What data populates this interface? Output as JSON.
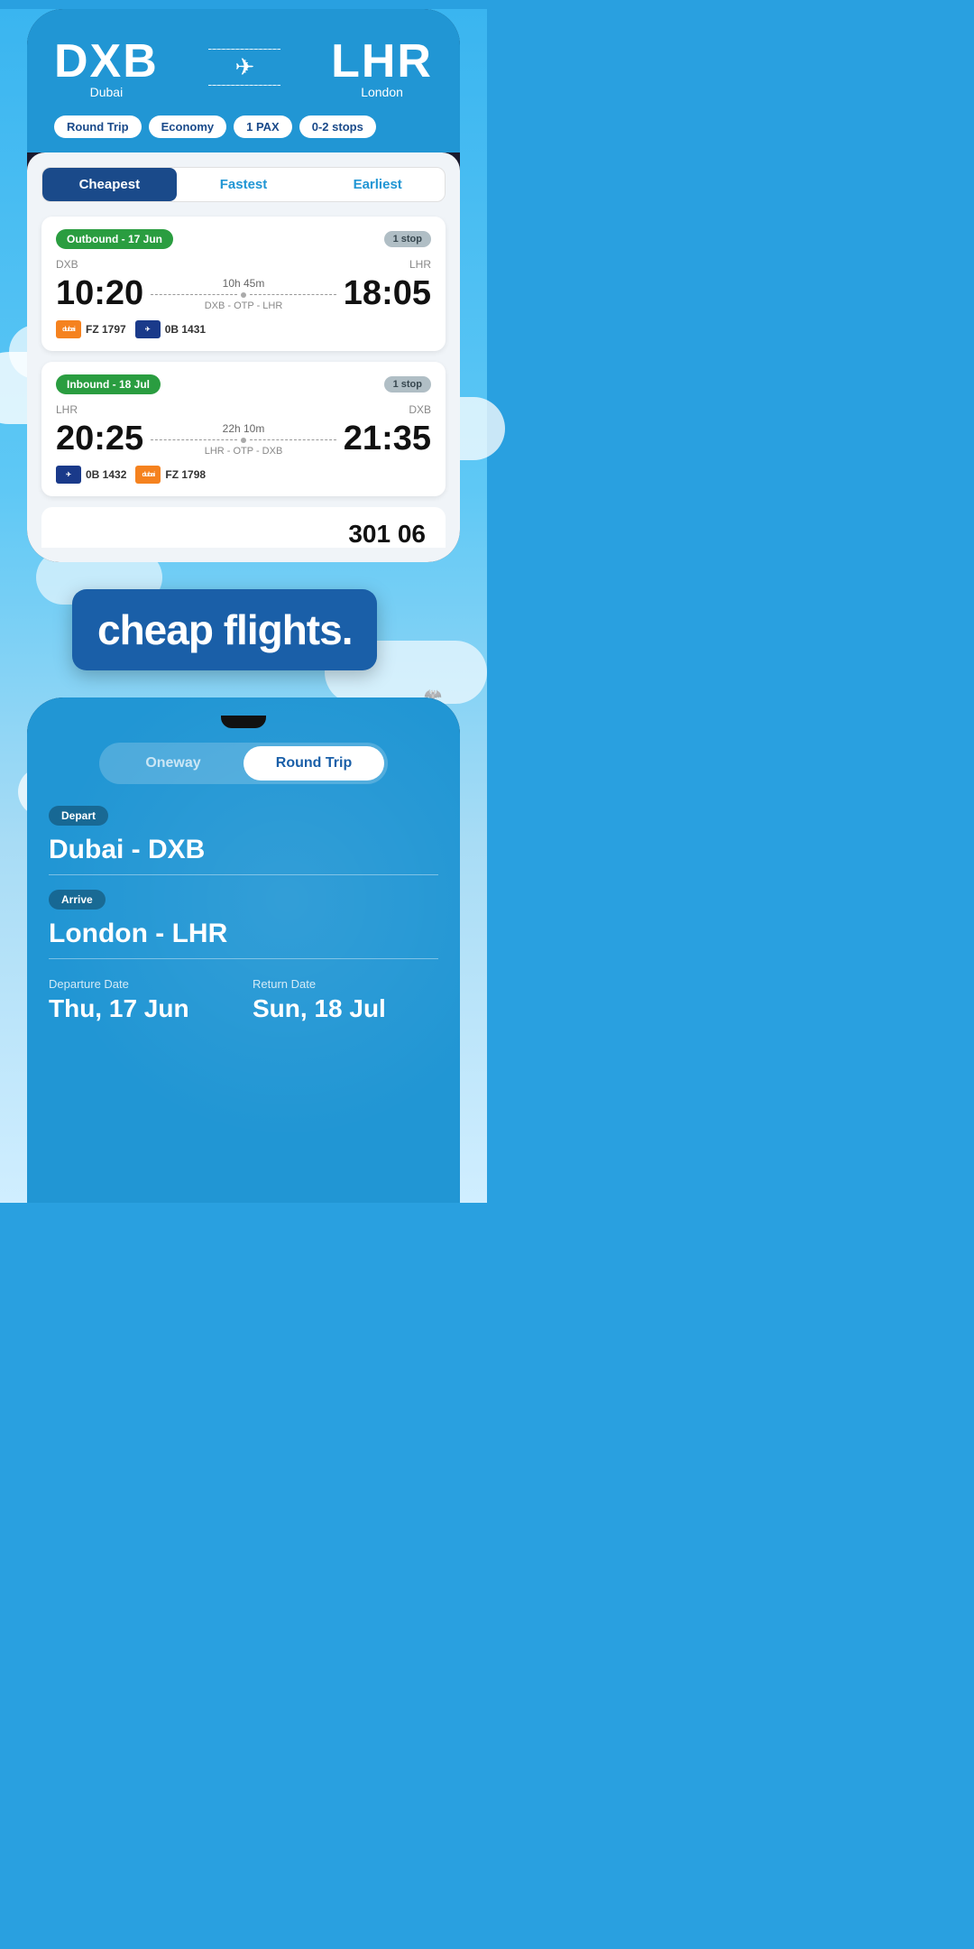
{
  "top_phone": {
    "origin_code": "DXB",
    "origin_name": "Dubai",
    "dest_code": "LHR",
    "dest_name": "London",
    "tags": {
      "trip_type": "Round Trip",
      "cabin": "Economy",
      "pax": "1 PAX",
      "stops": "0-2 stops"
    },
    "tabs": {
      "cheapest": "Cheapest",
      "fastest": "Fastest",
      "earliest": "Earliest"
    },
    "outbound": {
      "label": "Outbound - 17 Jun",
      "stop_badge": "1 stop",
      "origin": "DXB",
      "dest": "LHR",
      "depart_time": "10:20",
      "arrive_time": "18:05",
      "duration": "10h 45m",
      "route": "DXB - OTP - LHR",
      "airline1_code": "FZ 1797",
      "airline2_code": "0B 1431"
    },
    "inbound": {
      "label": "Inbound - 18 Jul",
      "stop_badge": "1 stop",
      "origin": "LHR",
      "dest": "DXB",
      "depart_time": "20:25",
      "arrive_time": "21:35",
      "duration": "22h 10m",
      "route": "LHR - OTP - DXB",
      "airline1_code": "0B 1432",
      "airline2_code": "FZ 1798"
    }
  },
  "middle": {
    "tagline": "cheap flights."
  },
  "bottom_phone": {
    "toggle": {
      "oneway": "Oneway",
      "round_trip": "Round Trip"
    },
    "depart_label": "Depart",
    "depart_value": "Dubai - DXB",
    "arrive_label": "Arrive",
    "arrive_value": "London - LHR",
    "departure_date_label": "Departure Date",
    "departure_date_value": "Thu, 17 Jun",
    "return_date_label": "Return Date",
    "return_date_value": "Sun, 18 Jul"
  }
}
